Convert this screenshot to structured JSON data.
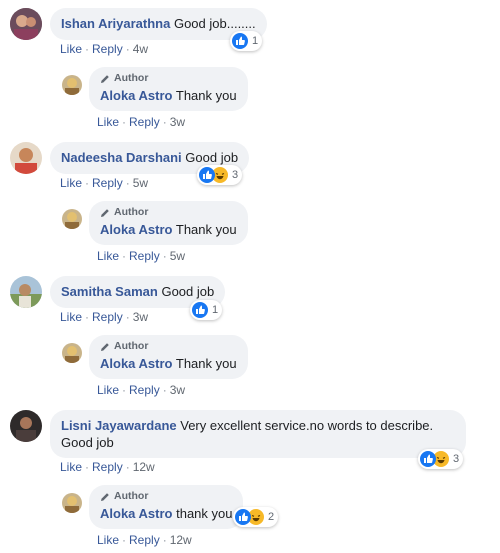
{
  "author_badge": "Author",
  "action_like": "Like",
  "action_reply": "Reply",
  "separator": "·",
  "comments": [
    {
      "name": "Ishan Ariyarathna",
      "text": "Good job........",
      "time": "4w",
      "reaction_count": "1",
      "reaction_icons": [
        "like"
      ],
      "reply": {
        "name": "Aloka Astro",
        "text": "Thank you",
        "time": "3w"
      }
    },
    {
      "name": "Nadeesha Darshani",
      "text": "Good job",
      "time": "5w",
      "reaction_count": "3",
      "reaction_icons": [
        "like",
        "haha"
      ],
      "reply": {
        "name": "Aloka Astro",
        "text": "Thank you",
        "time": "5w"
      }
    },
    {
      "name": "Samitha Saman",
      "text": "Good job",
      "time": "3w",
      "reaction_count": "1",
      "reaction_icons": [
        "like"
      ],
      "reply": {
        "name": "Aloka Astro",
        "text": "Thank you",
        "time": "3w"
      }
    },
    {
      "name": "Lisni Jayawardane",
      "text": "Very excellent service.no words to describe. Good job",
      "time": "12w",
      "reaction_count": "3",
      "reaction_icons": [
        "like",
        "haha"
      ],
      "reply": {
        "name": "Aloka Astro",
        "text": "thank you",
        "time": "12w",
        "reaction_count": "2",
        "reaction_icons": [
          "like",
          "haha"
        ]
      }
    }
  ],
  "colors": {
    "name_link": "#385898",
    "bubble_bg": "#f0f2f5",
    "like_blue": "#1877f2",
    "haha_yellow": "#f7b928",
    "meta_gray": "#606770"
  }
}
